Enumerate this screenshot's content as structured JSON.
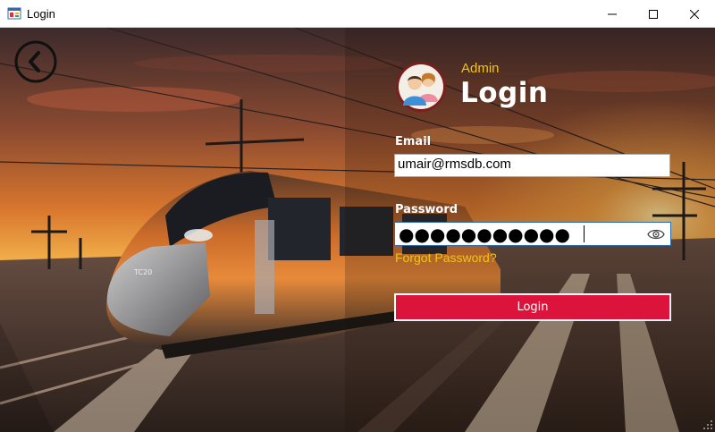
{
  "window": {
    "title": "Login",
    "app_icon": "winforms-app-icon",
    "controls": [
      "minimize-icon",
      "maximize-icon",
      "close-icon"
    ]
  },
  "back_button": {
    "icon": "chevron-left-icon"
  },
  "header": {
    "avatar_icon": "users-avatar-icon",
    "role": "Admin",
    "title": "Login"
  },
  "form": {
    "email_label": "Email",
    "email_value": "umair@rmsdb.com",
    "password_label": "Password",
    "password_masked": "●●●●●●●●●●●",
    "password_toggle_icon": "eye-icon",
    "forgot_link": "Forgot Password?",
    "submit_label": "Login"
  },
  "colors": {
    "accent_yellow": "#f2c318",
    "button_red": "#dc143c",
    "text_white": "#ffffff"
  }
}
